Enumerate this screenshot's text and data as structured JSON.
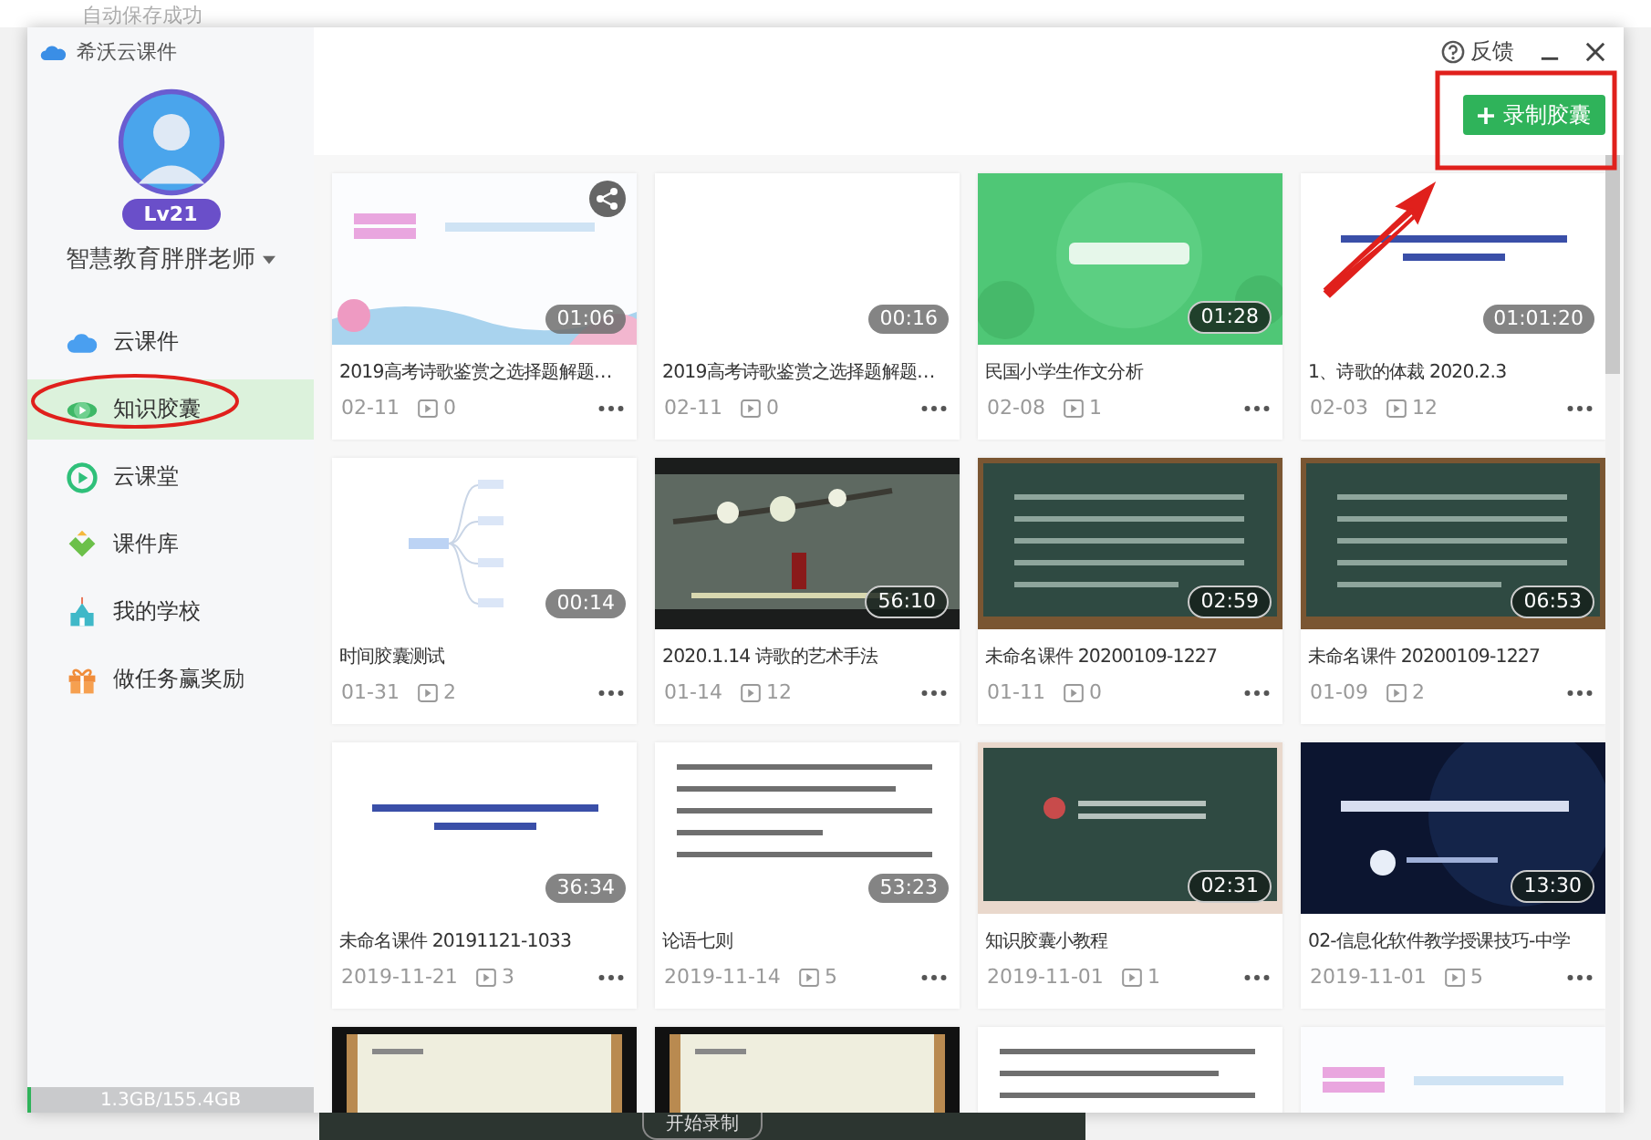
{
  "backdrop": {
    "status": "自动保存成功",
    "record_hint": "开始录制"
  },
  "window": {
    "title": "希沃云课件",
    "feedback": "反馈"
  },
  "user": {
    "name": "智慧教育胖胖老师",
    "level": "Lv21"
  },
  "nav": [
    {
      "kind": "cloud",
      "label": "云课件",
      "selected": false
    },
    {
      "kind": "capsule",
      "label": "知识胶囊",
      "selected": true
    },
    {
      "kind": "play",
      "label": "云课堂",
      "selected": false
    },
    {
      "kind": "library",
      "label": "课件库",
      "selected": false
    },
    {
      "kind": "school",
      "label": "我的学校",
      "selected": false
    },
    {
      "kind": "gift",
      "label": "做任务赢奖励",
      "selected": false
    }
  ],
  "storage": {
    "text": "1.3GB/155.4GB",
    "level": 0.01
  },
  "record_button": "录制胶囊",
  "cards": [
    {
      "shared": true,
      "duration": "01:06",
      "title": "2019高考诗歌鉴赏之选择题解题…",
      "date": "02-11",
      "count": "0"
    },
    {
      "shared": false,
      "duration": "00:16",
      "title": "2019高考诗歌鉴赏之选择题解题…",
      "date": "02-11",
      "count": "0"
    },
    {
      "shared": false,
      "duration": "01:28",
      "title": "民国小学生作文分析",
      "date": "02-08",
      "count": "1"
    },
    {
      "shared": false,
      "duration": "01:01:20",
      "title": "1、诗歌的体裁 2020.2.3",
      "date": "02-03",
      "count": "12"
    },
    {
      "shared": false,
      "duration": "00:14",
      "title": "时间胶囊测试",
      "date": "01-31",
      "count": "2"
    },
    {
      "shared": false,
      "duration": "56:10",
      "title": "2020.1.14 诗歌的艺术手法",
      "date": "01-14",
      "count": "12"
    },
    {
      "shared": false,
      "duration": "02:59",
      "title": "未命名课件 20200109-1227",
      "date": "01-11",
      "count": "0"
    },
    {
      "shared": false,
      "duration": "06:53",
      "title": "未命名课件 20200109-1227",
      "date": "01-09",
      "count": "2"
    },
    {
      "shared": false,
      "duration": "36:34",
      "title": "未命名课件 20191121-1033",
      "date": "2019-11-21",
      "count": "3"
    },
    {
      "shared": false,
      "duration": "53:23",
      "title": "论语七则",
      "date": "2019-11-14",
      "count": "5"
    },
    {
      "shared": false,
      "duration": "02:31",
      "title": "知识胶囊小教程",
      "date": "2019-11-01",
      "count": "1"
    },
    {
      "shared": false,
      "duration": "13:30",
      "title": "02-信息化软件教学授课技巧-中学",
      "date": "2019-11-01",
      "count": "5"
    },
    {
      "kind": "picture"
    },
    {
      "kind": "picture"
    },
    {
      "kind": "picture"
    },
    {
      "kind": "picture"
    }
  ]
}
